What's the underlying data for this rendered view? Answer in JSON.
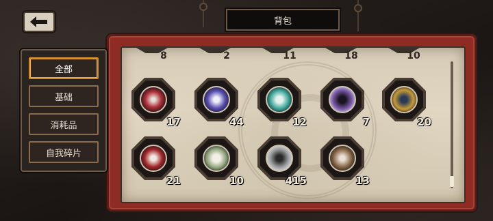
{
  "header": {
    "title": "背包"
  },
  "categories": [
    {
      "label": "全部",
      "active": true
    },
    {
      "label": "基础",
      "active": false
    },
    {
      "label": "消耗品",
      "active": false
    },
    {
      "label": "自我碎片",
      "active": false
    }
  ],
  "partial_row_counts": [
    "8",
    "2",
    "11",
    "18",
    "10"
  ],
  "items": [
    {
      "name": "red-black-emblem",
      "count": "17",
      "color": "#b0303a"
    },
    {
      "name": "purple-blue-emblem",
      "count": "44",
      "color": "#5b4fb0"
    },
    {
      "name": "teal-ring-emblem",
      "count": "12",
      "color": "#3ea79b"
    },
    {
      "name": "purple-crescent-emblem",
      "count": "7",
      "color": "#7a5aa8"
    },
    {
      "name": "gold-gear-emblem",
      "count": "20",
      "color": "#c59a3a"
    },
    {
      "name": "crimson-figure-emblem",
      "count": "21",
      "color": "#a3282c"
    },
    {
      "name": "white-green-emblem",
      "count": "10",
      "color": "#8fa37a"
    },
    {
      "name": "silver-dial-emblem",
      "count": "415",
      "color": "#9c9c9c"
    },
    {
      "name": "bronze-tentacle-emblem",
      "count": "13",
      "color": "#8a6a4a"
    }
  ]
}
